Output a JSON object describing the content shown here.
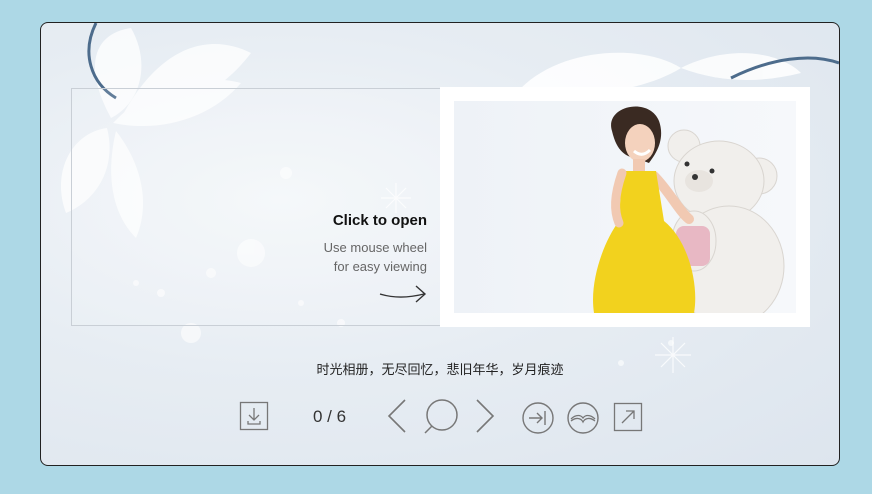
{
  "book": {
    "open_title": "Click to open",
    "hint_line1": "Use mouse wheel",
    "hint_line2": "for easy viewing"
  },
  "caption": "时光相册，无尽回忆，悲旧年华，岁月痕迹",
  "toolbar": {
    "page_counter": "0 / 6",
    "icons": [
      "download-icon",
      "prev-icon",
      "zoom-icon",
      "next-icon",
      "last-page-icon",
      "open-book-icon",
      "fullscreen-icon"
    ]
  },
  "colors": {
    "background": "#add8e6",
    "icon_stroke": "#777",
    "dress": "#f2d21e"
  }
}
